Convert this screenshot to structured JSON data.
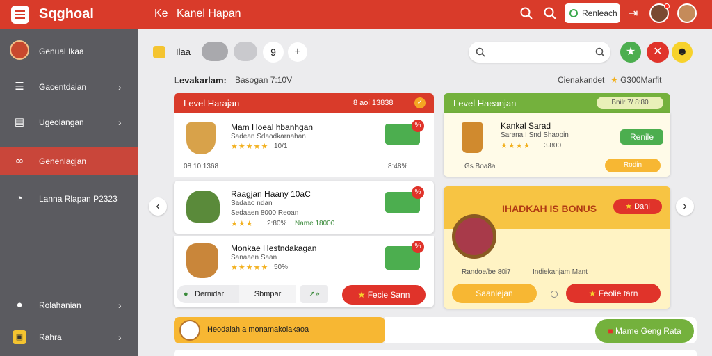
{
  "app": {
    "logo_text": "Sqghoal",
    "page_title": "Kanel Hapan",
    "page_prefix": "Ke"
  },
  "topbar": {
    "search_button_label": "Renleach"
  },
  "sidebar": {
    "profile_name": "Genual Ikaa",
    "items": [
      {
        "label": "Gacentdaian",
        "icon": "list-icon"
      },
      {
        "label": "Ugeolangan",
        "icon": "document-icon"
      },
      {
        "label": "Genenlagjan",
        "icon": "link-icon",
        "active": true
      },
      {
        "label": "Lanna Rlapan P2323",
        "icon": "timer-icon"
      },
      {
        "label": "Rolahanian",
        "icon": "user-icon"
      },
      {
        "label": "Rahra",
        "icon": "lock-icon"
      }
    ]
  },
  "toolbar": {
    "label": "Ilaa",
    "zoom": "9",
    "add": "+"
  },
  "heading": {
    "title": "Levakarlam:",
    "subtitle": "Basogan 7:10V",
    "right_text": "Cienakandet",
    "right_points": "G300Marfit"
  },
  "left_card": {
    "header": "Level Harajan",
    "header_count": "8 aoi 13838",
    "items": [
      {
        "title": "Mam Hoeal hbanhgan",
        "subtitle": "Sadean Sdaodkarnahan",
        "rating_text": "10/1",
        "meta": "08 10 1368",
        "value": "8:48%"
      },
      {
        "title": "Raagjan Haany 10aC",
        "subtitle": "Sadaao ndan",
        "rating_text": "2:80%",
        "meta": "Sedaaen 8000 Reoan",
        "value": "Name 18000"
      },
      {
        "title": "Monkae Hestndakagan",
        "subtitle": "Sanaaen Saan",
        "rating_text": "50%",
        "meta": "",
        "value": ""
      }
    ],
    "footer_left": "Dernidar",
    "footer_mid": "Sbmpar",
    "footer_action": "Fecie Sann"
  },
  "right_card": {
    "header": "Level Haeanjan",
    "header_count": "Bnilr 7/ 8:80",
    "item_title": "Kankal Sarad",
    "item_subtitle": "Sarana I Snd Shaopin",
    "item_rating": "3.800",
    "item_meta": "Gs Boa8a",
    "item_button": "Renile",
    "item_status": "Rodin",
    "bonus_title": "IHADKAH IS BONUS",
    "bonus_button": "Dani",
    "bonus_meta_left": "Randoe/be 80i7",
    "bonus_meta_right": "Indiekanjam Mant",
    "footer_left": "Saanlejan",
    "footer_action": "Feolie tarn"
  },
  "bottom_bar": {
    "text": "Heodalah a monamakolakaoa",
    "right_button": "Mame Geng Rata"
  },
  "colors": {
    "primary": "#d93b2a",
    "green": "#6ab04c",
    "orange": "#f5a623",
    "sidebar": "#5b5b60"
  }
}
